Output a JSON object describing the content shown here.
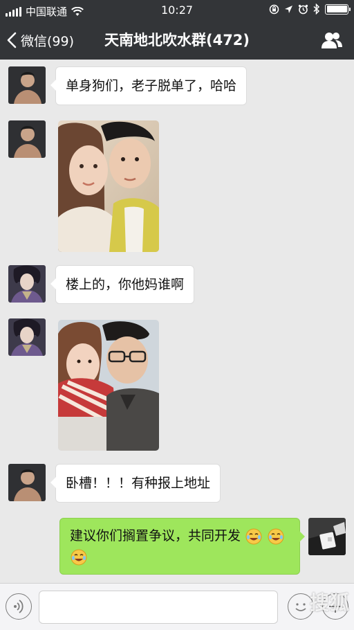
{
  "status_bar": {
    "carrier": "中国联通",
    "time": "10:27",
    "battery_level": 1.0
  },
  "nav": {
    "back_label": "微信(99)",
    "title": "天南地北吹水群(472)",
    "back_icon": "chevron-left-icon",
    "group_icon": "group-members-icon"
  },
  "messages": [
    {
      "type": "text",
      "side": "left",
      "sender_avatar": "male-avatar-1",
      "text": "单身狗们，老子脱单了，哈哈"
    },
    {
      "type": "image",
      "side": "left",
      "sender_avatar": "male-avatar-1",
      "description_icon": "couple-photo-1"
    },
    {
      "type": "text",
      "side": "left",
      "sender_avatar": "anime-avatar",
      "text": "楼上的，你他妈谁啊"
    },
    {
      "type": "image",
      "side": "left",
      "sender_avatar": "anime-avatar",
      "description_icon": "couple-photo-2"
    },
    {
      "type": "text",
      "side": "left",
      "sender_avatar": "male-avatar-1",
      "text": "卧槽！！！有种报上地址"
    },
    {
      "type": "text",
      "side": "right",
      "sender_avatar": "self-avatar",
      "text": "建议你们搁置争议，共同开发",
      "emoji_icons": [
        "laugh-cry-emoji",
        "laugh-cry-emoji",
        "laugh-cry-emoji"
      ]
    }
  ],
  "input_bar": {
    "voice_icon": "voice-icon",
    "emoji_icon": "emoji-face-icon",
    "plus_icon": "plus-icon",
    "input_value": "",
    "watermark": "搜狐"
  },
  "colors": {
    "nav_bg": "#333538",
    "chat_bg": "#e9e9e9",
    "self_bubble": "#9ee65c"
  }
}
